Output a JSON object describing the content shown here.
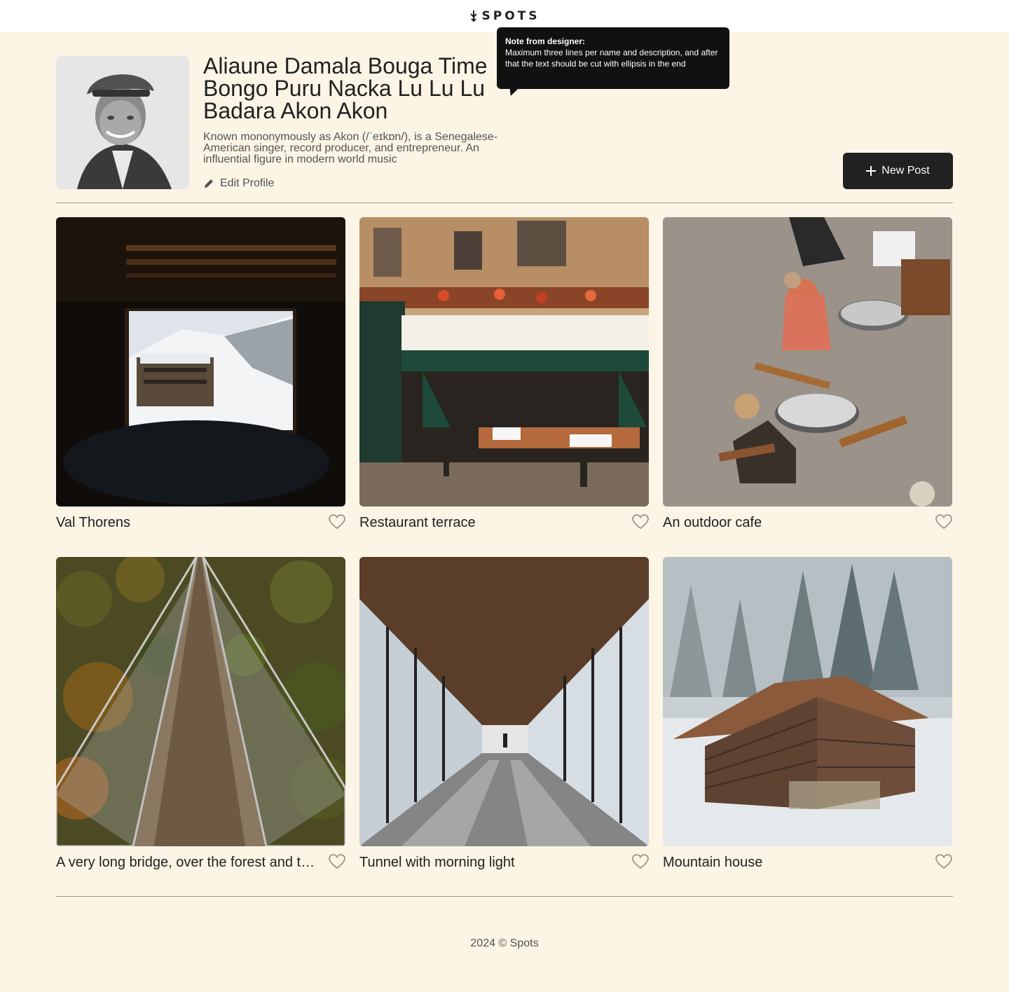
{
  "header": {
    "logo_text": "SPOTS",
    "logo_icon": "spots-logo-icon"
  },
  "profile": {
    "name": "Aliaune Damala Bouga Time Bongo Puru Nacka Lu Lu Lu Badara Akon Akon",
    "description": "Known mononymously as Akon (/ˈeɪkɒn/), is a Senegalese-American singer, record producer, and entrepreneur. An influential figure in modern world music",
    "edit_label": "Edit Profile",
    "edit_icon": "pencil-icon"
  },
  "tooltip": {
    "title": "Note from designer:",
    "body": "Maximum three lines per name and description, and after that the text should be cut with ellipsis in the end"
  },
  "actions": {
    "new_post_label": "New Post",
    "new_post_icon": "plus-icon"
  },
  "cards": [
    {
      "title": "Val Thorens"
    },
    {
      "title": "Restaurant terrace"
    },
    {
      "title": "An outdoor cafe"
    },
    {
      "title": "A very long bridge, over the forest and through the trees"
    },
    {
      "title": "Tunnel with morning light"
    },
    {
      "title": "Mountain house"
    }
  ],
  "footer": {
    "text": "2024 © Spots"
  },
  "colors": {
    "background": "#fcf5e5",
    "header_bg": "#ffffff",
    "text": "#212121",
    "muted": "#545454",
    "button_bg": "#212121",
    "tooltip_bg": "#111111"
  }
}
